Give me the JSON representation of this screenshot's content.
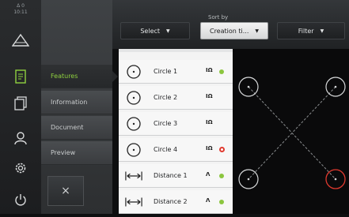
{
  "status": {
    "signal": "Δ 0",
    "time": "10:11"
  },
  "rail": {
    "icons": [
      "home-icon",
      "report-icon",
      "documents-icon",
      "user-icon",
      "settings-icon",
      "power-icon"
    ]
  },
  "nav": {
    "items": [
      {
        "label": "Features",
        "active": true
      },
      {
        "label": "Information",
        "active": false
      },
      {
        "label": "Document",
        "active": false
      },
      {
        "label": "Preview",
        "active": false
      }
    ],
    "close_symbol": "×"
  },
  "toolbar": {
    "select_label": "Select",
    "sort_by_label": "Sort by",
    "sort_value": "Creation ti...",
    "filter_label": "Filter"
  },
  "features": [
    {
      "name": "Circle 1",
      "type": "IΩ",
      "status": "ok",
      "icon": "circle-feature-icon"
    },
    {
      "name": "Circle 2",
      "type": "IΩ",
      "status": "none",
      "icon": "circle-feature-icon"
    },
    {
      "name": "Circle 3",
      "type": "IΩ",
      "status": "none",
      "icon": "circle-feature-icon"
    },
    {
      "name": "Circle 4",
      "type": "IΩ",
      "status": "error",
      "icon": "circle-feature-icon"
    },
    {
      "name": "Distance 1",
      "type": "Λ",
      "status": "ok",
      "icon": "distance-feature-icon"
    },
    {
      "name": "Distance 2",
      "type": "Λ",
      "status": "ok",
      "icon": "distance-feature-icon"
    }
  ],
  "colors": {
    "active_green": "#8fd13f",
    "ok_green": "#8cc63f",
    "error_red": "#e03a2f"
  }
}
